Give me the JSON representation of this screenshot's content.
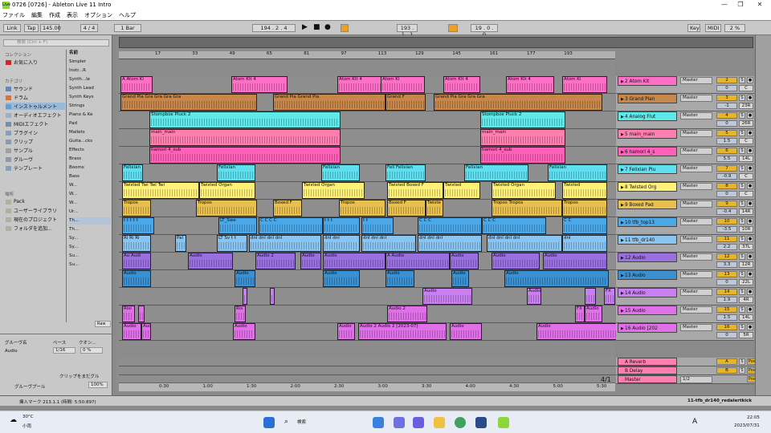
{
  "window": {
    "title": "0726  [0726] - Ableton Live 11 Intro",
    "app_icon_text": "Live",
    "minimize": "—",
    "restore": "❐",
    "close": "✕"
  },
  "menu": [
    "ファイル",
    "編集",
    "作成",
    "表示",
    "オプション",
    "ヘルプ"
  ],
  "transport": {
    "link": "Link",
    "tap": "Tap",
    "tempo": "145.00",
    "signature": "4 / 4",
    "quantize": "1 Bar",
    "position": "194 .  2 .  4",
    "loop_start": "193 .  1 .  1",
    "loop_length": "19 .  0 .  0",
    "key": "Key",
    "midi": "MIDI",
    "cpu": "2 %",
    "h_btn": "H",
    "w_btn": "W",
    "play": "▶",
    "stop": "■",
    "record": "●"
  },
  "browser": {
    "search_placeholder": "検索 (Ctrl + F)",
    "collections_header": "コレクション",
    "favorites": "お気に入り",
    "categories_header": "カテゴリ",
    "categories": [
      "サウンド",
      "ドラム",
      "インストゥルメント",
      "オーディオエフェクト",
      "MIDIエフェクト",
      "プラグイン",
      "クリップ",
      "サンプル",
      "グルーヴ",
      "テンプレート"
    ],
    "places_header": "場所",
    "places": [
      "Pack",
      "ユーザーライブラリ",
      "現在のプロジェクト",
      "フォルダを追加..."
    ],
    "name_header": "名前",
    "files": [
      "Simpler",
      "Instr...R",
      "Synth...le",
      "Synth Lead",
      "Synth Keys",
      "Strings",
      "Piano & Ke",
      "Pad",
      "Mallets",
      "Guita...cks",
      "Effects",
      "Brass",
      "Booms",
      "Bass",
      "W...",
      "W...",
      "W...",
      "Ur...",
      "Th...",
      "Th...",
      "Sy...",
      "Sy...",
      "Su...",
      "Su..."
    ],
    "raw": "Raw"
  },
  "groove": {
    "header_name": "グルーヴ名",
    "header_base": "ベース",
    "header_quant": "クオン...",
    "item": "Audio",
    "base": "1/16",
    "quant": "0 %",
    "hint": "クリップをまだグル",
    "pool": "グルーヴプール",
    "amount": "100%"
  },
  "ruler": [
    "17",
    "33",
    "49",
    "65",
    "81",
    "97",
    "113",
    "129",
    "145",
    "161",
    "177",
    "193"
  ],
  "time_ruler": [
    "0:30",
    "1:00",
    "1:30",
    "2:00",
    "2:30",
    "3:00",
    "3:30",
    "4:00",
    "4:30",
    "5:00",
    "5:30"
  ],
  "tracks": [
    {
      "name": "2 Atom Kit",
      "color": "#ff6ec7",
      "io": "Master",
      "num": "2",
      "vol": "0",
      "pan": "C",
      "clips": [
        [
          "A Atom Ki",
          150,
          40
        ],
        [
          "Atom Kit 4",
          288,
          70
        ],
        [
          "Atom Kit 4",
          420,
          58
        ],
        [
          "Atom Ki",
          474,
          55
        ],
        [
          "Atom Kit 4",
          552,
          46
        ],
        [
          "Atom Kit 4",
          630,
          60
        ],
        [
          "Atom Ki",
          700,
          56
        ]
      ]
    },
    {
      "name": "3 Grand Pian",
      "color": "#c8874a",
      "io": "Master",
      "num": "3",
      "vol": "-1",
      "pan": "23R",
      "clips": [
        [
          "Grand Pia Gra Gra Gra Gra",
          150,
          170
        ],
        [
          "Grand Pia Grand Pia",
          340,
          140
        ],
        [
          "Grand F",
          480,
          50
        ],
        [
          "Grand Pia Gra Gra Gra",
          540,
          210
        ]
      ]
    },
    {
      "name": "4 Analog Flut",
      "color": "#5ee8e8",
      "io": "Master",
      "num": "4",
      "vol": "0",
      "pan": "26R",
      "clips": [
        [
          "Stompbox Pluck 2",
          186,
          238
        ],
        [
          "Stompbox Pluck 2",
          598,
          106
        ]
      ]
    },
    {
      "name": "5 main_main",
      "color": "#ff80b0",
      "io": "Master",
      "num": "5",
      "vol": "1.5",
      "pan": "C",
      "clips": [
        [
          "main_main",
          186,
          238
        ],
        [
          "main_main",
          598,
          106
        ]
      ]
    },
    {
      "name": "6 hamori 4_s",
      "color": "#ff60b8",
      "io": "Master",
      "num": "6",
      "vol": "5.5",
      "pan": "14L",
      "clips": [
        [
          "hamori 4_sub",
          186,
          238
        ],
        [
          "hamori 4_sub",
          598,
          106
        ]
      ]
    },
    {
      "name": "7 Felixian Plu",
      "color": "#5ee0f0",
      "io": "Master",
      "num": "7",
      "vol": "-0.9",
      "pan": "C",
      "clips": [
        [
          "Felixian",
          152,
          26
        ],
        [
          "Felixian",
          270,
          48
        ],
        [
          "Felixian",
          400,
          48
        ],
        [
          "Feli Felixian",
          480,
          50
        ],
        [
          "Felixian",
          578,
          80
        ],
        [
          "Felixian",
          682,
          74
        ]
      ]
    },
    {
      "name": "8 Twisted Org",
      "color": "#fff078",
      "io": "Master",
      "num": "8",
      "vol": "0",
      "pan": "C",
      "clips": [
        [
          "Twisted Twi Twi Twi",
          152,
          96
        ],
        [
          "Twisted Organ",
          248,
          70
        ],
        [
          "Twisted Organ",
          376,
          78
        ],
        [
          "Twisted Boxed F",
          482,
          70
        ],
        [
          "Twisted",
          552,
          46
        ],
        [
          "Twisted Organ",
          612,
          80
        ],
        [
          "Twisted",
          700,
          56
        ]
      ]
    },
    {
      "name": "9 Boxed Pad",
      "color": "#e8c050",
      "io": "Master",
      "num": "9",
      "vol": "-0.4",
      "pan": "14R",
      "clips": [
        [
          "Tropos",
          152,
          36
        ],
        [
          "Tropos",
          244,
          76
        ],
        [
          "Boxed F",
          340,
          36
        ],
        [
          "Tropos",
          422,
          58
        ],
        [
          "Boxed F",
          482,
          48
        ],
        [
          "Twiste",
          530,
          22
        ],
        [
          "Tropos Tropos",
          612,
          88
        ],
        [
          "Tropos",
          700,
          56
        ]
      ]
    },
    {
      "name": "10 tfb_top13",
      "color": "#4aa8e8",
      "io": "Master",
      "num": "10",
      "vol": "-3.5",
      "pan": "10R",
      "clips": [
        [
          "t t t t t",
          152,
          40
        ],
        [
          "LT_Swe",
          272,
          48
        ],
        [
          "C C C C",
          322,
          80
        ],
        [
          "t t t",
          402,
          46
        ],
        [
          "t t",
          450,
          40
        ],
        [
          "C C C",
          520,
          80
        ],
        [
          "C C C",
          600,
          80
        ],
        [
          "C C",
          700,
          56
        ]
      ]
    },
    {
      "name": "11 tfb_dr140",
      "color": "#8ac4f0",
      "io": "Master",
      "num": "11",
      "vol": "2.2",
      "pan": "37L",
      "clips": [
        [
          "Ri Ri Ri",
          152,
          36
        ],
        [
          "Pal",
          218,
          14
        ],
        [
          "LT Sv t t",
          270,
          38
        ],
        [
          "dnl dnl dnl dnl",
          310,
          90
        ],
        [
          "dnl dnl",
          402,
          46
        ],
        [
          "dnl dnl dnl",
          450,
          68
        ],
        [
          "dnl dnl dnl",
          520,
          80
        ],
        [
          "dnl dnl dnl dnl",
          606,
          94
        ],
        [
          "dnl",
          700,
          56
        ]
      ]
    },
    {
      "name": "12 Audio",
      "color": "#9a70e0",
      "io": "Master",
      "num": "12",
      "vol": "3.3",
      "pan": "12R",
      "clips": [
        [
          "Au Audi",
          152,
          36
        ],
        [
          "Audio",
          234,
          56
        ],
        [
          "Audio 2",
          318,
          50
        ],
        [
          "Audio",
          374,
          26
        ],
        [
          "Audio",
          402,
          78
        ],
        [
          "A Audio",
          480,
          80
        ],
        [
          "Audio",
          560,
          36
        ],
        [
          "Audio",
          612,
          60
        ],
        [
          "Audio",
          676,
          80
        ]
      ]
    },
    {
      "name": "13 Audio",
      "color": "#3a90d0",
      "io": "Master",
      "num": "13",
      "vol": "0",
      "pan": "22L",
      "clips": [
        [
          "Audio",
          152,
          36
        ],
        [
          "Audio",
          292,
          26
        ],
        [
          "Audio",
          402,
          46
        ],
        [
          "Audio",
          480,
          36
        ],
        [
          "Audio",
          562,
          22
        ],
        [
          "Audio",
          628,
          130
        ]
      ]
    },
    {
      "name": "14 Audio",
      "color": "#c880f0",
      "io": "Master",
      "num": "14",
      "vol": "1.9",
      "pan": "4R",
      "clips": [
        [
          "",
          302,
          6
        ],
        [
          "",
          336,
          6
        ],
        [
          "Audio",
          526,
          62
        ],
        [
          "Audio",
          656,
          18
        ],
        [
          "",
          728,
          14
        ],
        [
          "FX",
          752,
          14
        ]
      ]
    },
    {
      "name": "15 Audio",
      "color": "#e070e8",
      "io": "Master",
      "num": "15",
      "vol": "1.5",
      "pan": "14L",
      "clips": [
        [
          "Risi",
          152,
          16
        ],
        [
          "",
          172,
          8
        ],
        [
          "Ris",
          292,
          14
        ],
        [
          "Audio 2",
          482,
          50
        ],
        [
          "FX",
          716,
          12
        ],
        [
          "Audio",
          728,
          22
        ]
      ]
    },
    {
      "name": "16 Audio [202",
      "color": "#e070e8",
      "io": "Master",
      "num": "16",
      "vol": "0",
      "pan": "5R",
      "clips": [
        [
          "Audio",
          152,
          24
        ],
        [
          "Audio",
          176,
          12
        ],
        [
          "Audio",
          290,
          28
        ],
        [
          "Audio",
          420,
          22
        ],
        [
          "Audio 2 Audio 2 [2023-07]",
          446,
          110
        ],
        [
          "Audio",
          560,
          40
        ],
        [
          "Audio",
          668,
          112
        ]
      ]
    }
  ],
  "returns": [
    {
      "name": "A Reverb",
      "color": "#ff80b0",
      "num": "A",
      "post": "Post"
    },
    {
      "name": "B Delay",
      "color": "#ff80b0",
      "num": "B",
      "post": "Post"
    }
  ],
  "master": {
    "name": "Master",
    "color": "#ff80b0",
    "io": "1/2",
    "post": "Post",
    "counter": "4/1"
  },
  "status": {
    "left": "挿入マーク 213.1.1 (時間: 5:50:897)",
    "right": "11-tfb_dr140_redalertkick"
  },
  "taskbar": {
    "temp": "30°C",
    "weather": "小雨",
    "search": "検索",
    "time": "22:05",
    "date": "2023/07/31",
    "ime": "A"
  }
}
